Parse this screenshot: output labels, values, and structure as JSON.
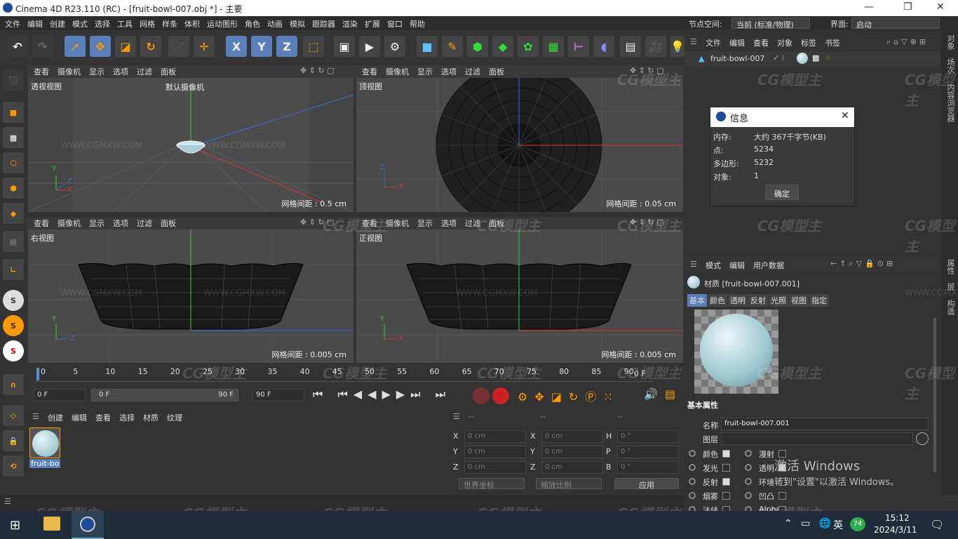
{
  "window": {
    "title": "Cinema 4D R23.110 (RC) - [fruit-bowl-007.obj *] - 主要"
  },
  "menu": [
    "文件",
    "编辑",
    "创建",
    "模式",
    "选择",
    "工具",
    "网格",
    "样条",
    "体积",
    "运动图形",
    "角色",
    "动画",
    "模拟",
    "跟踪器",
    "渲染",
    "扩展",
    "窗口",
    "帮助"
  ],
  "node_space": {
    "label": "节点空间:",
    "value": "当前 (标准/物理)"
  },
  "layout": {
    "label": "界面:",
    "value": "启动"
  },
  "toolbar": {
    "x_label": "X",
    "y_label": "Y",
    "z_label": "Z"
  },
  "viewport_menu": [
    "查看",
    "摄像机",
    "显示",
    "选项",
    "过滤",
    "面板"
  ],
  "viewports": {
    "persp": {
      "name": "透视视图",
      "camera": "默认摄像机",
      "grid": "网格间距 : 0.5 cm"
    },
    "top": {
      "name": "顶视图",
      "grid": "网格间距 : 0.05 cm"
    },
    "right": {
      "name": "右视图",
      "grid": "网格间距 : 0.005 cm"
    },
    "front": {
      "name": "正视图",
      "grid": "网格间距 : 0.005 cm"
    }
  },
  "axes": {
    "x": "X",
    "y": "Y",
    "z": "Z"
  },
  "watermark": {
    "site": "WWW.CGMXW.COM",
    "brand": "CG模型主"
  },
  "timeline": {
    "ticks": [
      "0",
      "5",
      "10",
      "15",
      "20",
      "25",
      "30",
      "35",
      "40",
      "45",
      "50",
      "55",
      "60",
      "65",
      "70",
      "75",
      "80",
      "85",
      "90"
    ],
    "end_frame": "0 F",
    "start_field": "0 F",
    "range_start": "0 F",
    "range_end": "90 F",
    "max_field": "90 F"
  },
  "material_panel": {
    "menu": [
      "创建",
      "编辑",
      "查看",
      "选择",
      "材质",
      "纹理"
    ],
    "item_label": "fruit-bo"
  },
  "coords": {
    "dashes": [
      "--",
      "--",
      "--"
    ],
    "rows": [
      {
        "a": "X",
        "av": "0 cm",
        "b": "X",
        "bv": "0 cm",
        "c": "H",
        "cv": "0 °"
      },
      {
        "a": "Y",
        "av": "0 cm",
        "b": "Y",
        "bv": "0 cm",
        "c": "P",
        "cv": "0 °"
      },
      {
        "a": "Z",
        "av": "0 cm",
        "b": "Z",
        "bv": "0 cm",
        "c": "B",
        "cv": "0 °"
      }
    ],
    "world": "世界坐标",
    "scale": "缩放比例",
    "apply": "应用"
  },
  "object_manager": {
    "menu": [
      "文件",
      "编辑",
      "查看",
      "对象",
      "标签",
      "书签"
    ],
    "object": "fruit-bowl-007"
  },
  "info_dialog": {
    "title": "信息",
    "rows": [
      {
        "k": "内存:",
        "v": "大约 367千字节(KB)"
      },
      {
        "k": "点:",
        "v": "5234"
      },
      {
        "k": "多边形:",
        "v": "5232"
      },
      {
        "k": "对象:",
        "v": "1"
      }
    ],
    "ok": "确定"
  },
  "attributes": {
    "menu": [
      "模式",
      "编辑",
      "用户数据"
    ],
    "title": "材质 [fruit-bowl-007.001]",
    "tabs": [
      "基本",
      "颜色",
      "透明",
      "反射",
      "光照",
      "视图",
      "指定"
    ],
    "section": "基本属性",
    "name_label": "名称",
    "name_value": "fruit-bowl-007.001",
    "layer_label": "图层",
    "channels": [
      {
        "l": "颜色",
        "on": true
      },
      {
        "l": "漫射",
        "on": false
      },
      {
        "l": "发光",
        "on": false
      },
      {
        "l": "透明",
        "on": true
      },
      {
        "l": "反射",
        "on": true
      },
      {
        "l": "环境",
        "on": false
      },
      {
        "l": "烟雾",
        "on": false
      },
      {
        "l": "凹凸",
        "on": false
      },
      {
        "l": "法线",
        "on": false
      },
      {
        "l": "Alpha",
        "on": false
      }
    ]
  },
  "right_tabs": [
    "对象",
    "场次",
    "内容浏览器",
    "属性",
    "层",
    "构造"
  ],
  "activation": {
    "line1": "激活 Windows",
    "line2": "转到\"设置\"以激活 Windows。"
  },
  "taskbar": {
    "time": "15:12",
    "date": "2024/3/11",
    "ime": "英",
    "badge": "74"
  }
}
